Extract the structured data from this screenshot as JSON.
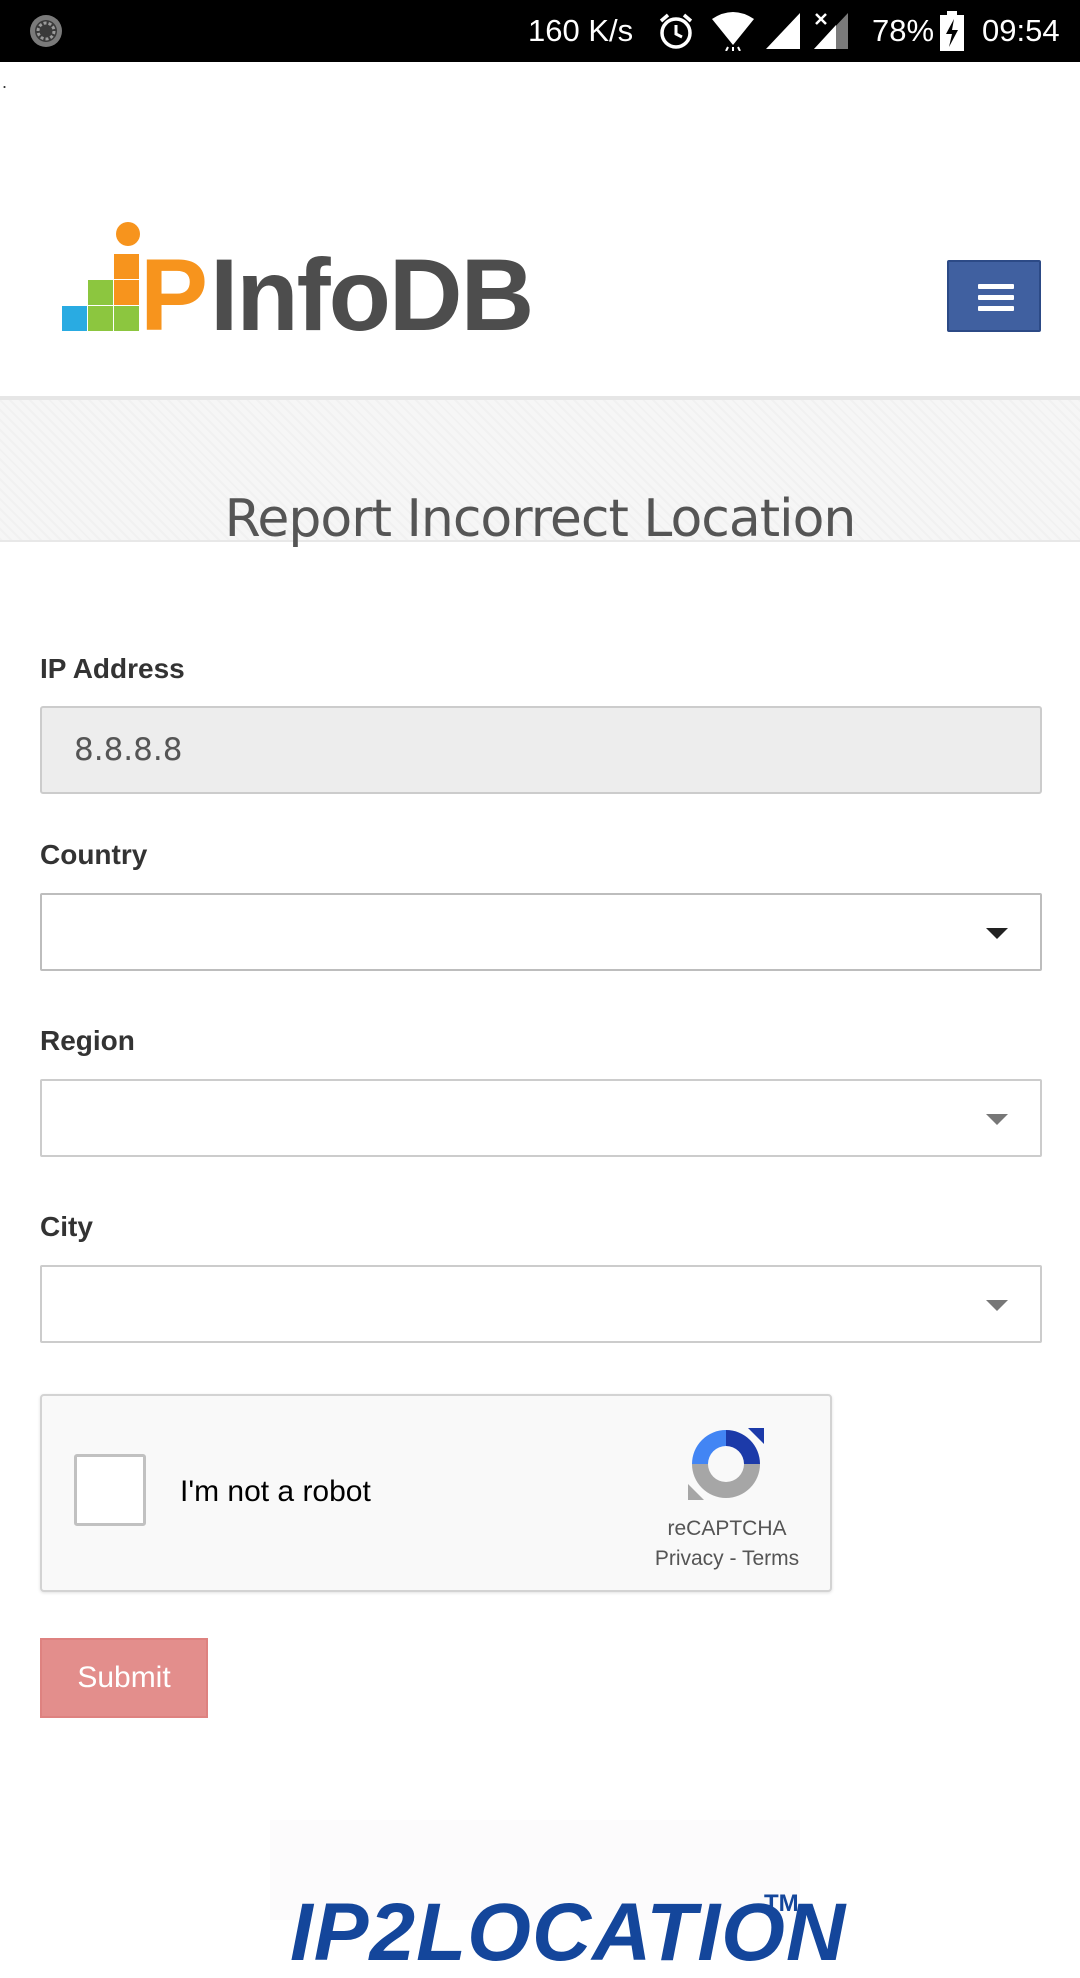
{
  "status_bar": {
    "net_speed": "160 K/s",
    "battery_percent": "78%",
    "time": "09:54",
    "icons": [
      "loading-circle-icon",
      "alarm-icon",
      "wifi-icon",
      "signal-icon",
      "signal-no-data-icon",
      "battery-charging-icon"
    ]
  },
  "page": {
    "stray_text": ".",
    "logo_text": "IPInfoDB",
    "menu_icon": "hamburger-menu-icon",
    "title": "Report Incorrect Location"
  },
  "form": {
    "ip_label": "IP Address",
    "ip_value": "8.8.8.8",
    "country_label": "Country",
    "country_value": "",
    "region_label": "Region",
    "region_value": "",
    "city_label": "City",
    "city_value": ""
  },
  "recaptcha": {
    "checkbox_label": "I'm not a robot",
    "brand": "reCAPTCHA",
    "privacy": "Privacy",
    "separator": " - ",
    "terms": "Terms",
    "checked": false
  },
  "submit_label": "Submit",
  "footer": {
    "logo_text": "IP2LOCATION",
    "trademark": "TM"
  },
  "colors": {
    "menu_button": "#4060a0",
    "submit_button": "#e38e8c",
    "logo_orange": "#f7941d",
    "logo_gray": "#4d4d4d",
    "footer_logo": "#14469b"
  }
}
